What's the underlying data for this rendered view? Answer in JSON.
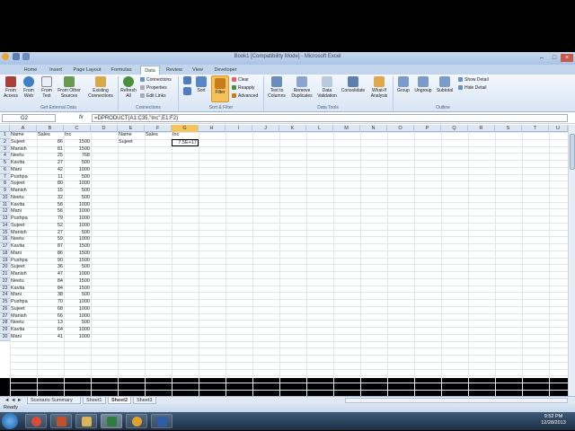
{
  "window": {
    "title": "Book1 [Compatibility Mode] - Microsoft Excel"
  },
  "ribbon_tabs": [
    "Home",
    "Insert",
    "Page Layout",
    "Formulas",
    "Data",
    "Review",
    "View",
    "Developer"
  ],
  "active_tab": "Data",
  "ribbon": {
    "get_external": {
      "from_access": "From Access",
      "from_web": "From Web",
      "from_text": "From Text",
      "from_other": "From Other Sources",
      "existing": "Existing Connections",
      "group": "Get External Data"
    },
    "connections": {
      "refresh": "Refresh All",
      "connections": "Connections",
      "properties": "Properties",
      "edit_links": "Edit Links",
      "group": "Connections"
    },
    "sort_filter": {
      "sort": "Sort",
      "filter": "Filter",
      "clear": "Clear",
      "reapply": "Reapply",
      "advanced": "Advanced",
      "group": "Sort & Filter"
    },
    "data_tools": {
      "text_to_columns": "Text to Columns",
      "remove_duplicates": "Remove Duplicates",
      "data_validation": "Data Validation",
      "consolidate": "Consolidate",
      "what_if": "What-If Analysis",
      "group": "Data Tools"
    },
    "outline": {
      "group_btn": "Group",
      "ungroup": "Ungroup",
      "subtotal": "Subtotal",
      "show_detail": "Show Detail",
      "hide_detail": "Hide Detail",
      "group": "Outline"
    }
  },
  "formula_bar": {
    "name_box": "G2",
    "fx": "fx",
    "formula": "=DPRODUCT(A1:C35,\"Inc\",E1:F2)"
  },
  "columns": [
    "A",
    "B",
    "C",
    "D",
    "E",
    "F",
    "G",
    "H",
    "I",
    "J",
    "K",
    "L",
    "M",
    "N",
    "O",
    "P",
    "Q",
    "R",
    "S",
    "T",
    "U"
  ],
  "selected_column": "G",
  "rows": [
    {
      "n": "1",
      "a": "Name",
      "b": "Sales",
      "c": "Inc"
    },
    {
      "n": "2",
      "a": "Sujeet",
      "b": "86",
      "c": "1500"
    },
    {
      "n": "3",
      "a": "Manish",
      "b": "81",
      "c": "1500"
    },
    {
      "n": "4",
      "a": "Neetu",
      "b": "25",
      "c": "768"
    },
    {
      "n": "5",
      "a": "Kavita",
      "b": "27",
      "c": "500"
    },
    {
      "n": "6",
      "a": "Mani",
      "b": "42",
      "c": "1000"
    },
    {
      "n": "7",
      "a": "Pushpa",
      "b": "11",
      "c": "500"
    },
    {
      "n": "8",
      "a": "Sujeet",
      "b": "80",
      "c": "1000"
    },
    {
      "n": "9",
      "a": "Manish",
      "b": "15",
      "c": "500"
    },
    {
      "n": "10",
      "a": "Neetu",
      "b": "32",
      "c": "500"
    },
    {
      "n": "11",
      "a": "Kavita",
      "b": "58",
      "c": "1000"
    },
    {
      "n": "12",
      "a": "Mani",
      "b": "56",
      "c": "1000"
    },
    {
      "n": "13",
      "a": "Pushpa",
      "b": "79",
      "c": "1000"
    },
    {
      "n": "14",
      "a": "Sujeet",
      "b": "52",
      "c": "1000"
    },
    {
      "n": "15",
      "a": "Manish",
      "b": "27",
      "c": "500"
    },
    {
      "n": "16",
      "a": "Neetu",
      "b": "59",
      "c": "1000"
    },
    {
      "n": "17",
      "a": "Kavita",
      "b": "87",
      "c": "1500"
    },
    {
      "n": "18",
      "a": "Mani",
      "b": "86",
      "c": "1500"
    },
    {
      "n": "19",
      "a": "Pushpa",
      "b": "90",
      "c": "1500"
    },
    {
      "n": "20",
      "a": "Sujeet",
      "b": "36",
      "c": "500"
    },
    {
      "n": "21",
      "a": "Manish",
      "b": "47",
      "c": "1000"
    },
    {
      "n": "22",
      "a": "Neetu",
      "b": "84",
      "c": "1500"
    },
    {
      "n": "23",
      "a": "Kavita",
      "b": "84",
      "c": "1500"
    },
    {
      "n": "24",
      "a": "Mani",
      "b": "38",
      "c": "500"
    },
    {
      "n": "25",
      "a": "Pushpa",
      "b": "70",
      "c": "1000"
    },
    {
      "n": "26",
      "a": "Sujeet",
      "b": "68",
      "c": "1000"
    },
    {
      "n": "27",
      "a": "Manish",
      "b": "66",
      "c": "1000"
    },
    {
      "n": "28",
      "a": "Neetu",
      "b": "13",
      "c": "500"
    },
    {
      "n": "29",
      "a": "Kavita",
      "b": "64",
      "c": "1000"
    },
    {
      "n": "30",
      "a": "Mani",
      "b": "41",
      "c": "1000"
    }
  ],
  "criteria": {
    "e1": "Name",
    "f1": "Sales",
    "g1": "Inc",
    "e2": "Sujeet",
    "g2": "7.5E+17"
  },
  "sheet_tabs": [
    "Scenario Summary",
    "Sheet1",
    "Sheet2",
    "Sheet3"
  ],
  "active_sheet": "Sheet2",
  "status": {
    "ready": "Ready"
  },
  "clock": {
    "time": "9:52 PM",
    "date": "12/28/2013"
  }
}
